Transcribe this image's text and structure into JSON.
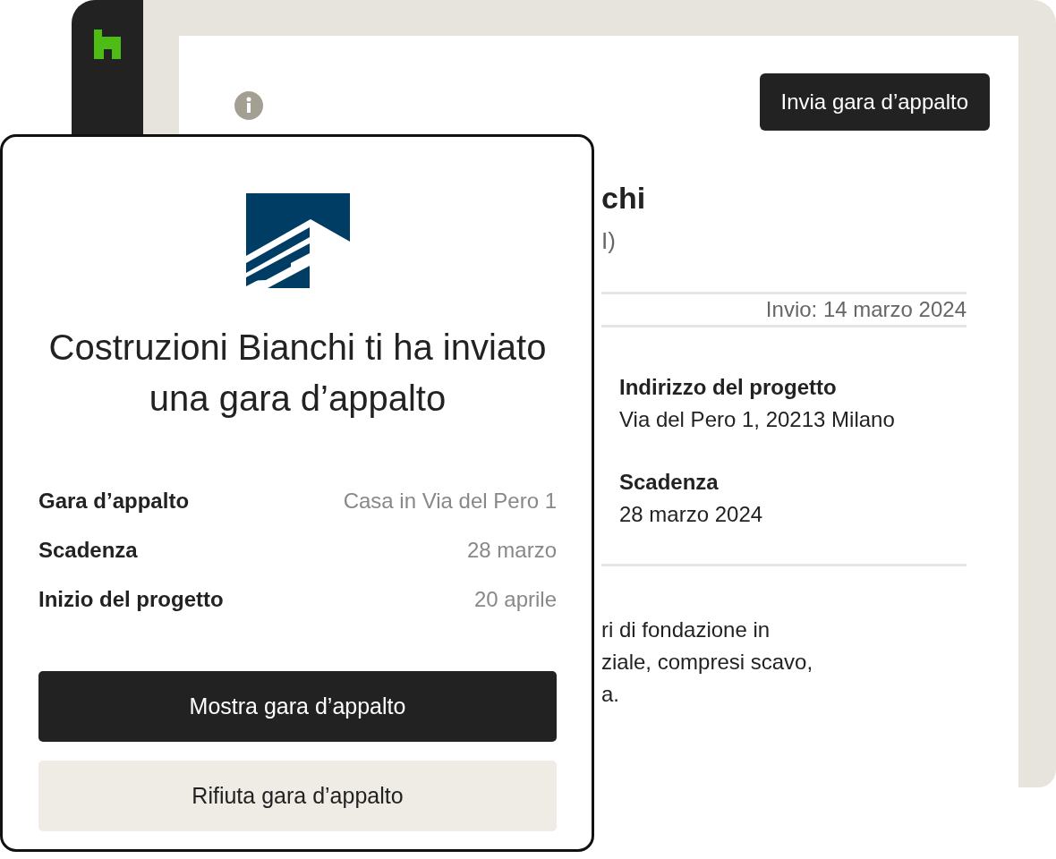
{
  "app": {
    "send_button": "Invia gara d’appalto",
    "header_fragments": [
      "chi",
      "I)"
    ],
    "sent_date": "Invio: 14 marzo 2024",
    "details": [
      {
        "label": "Indirizzo del progetto",
        "value": "Via del Pero 1, 20213 Milano"
      },
      {
        "label": "Scadenza",
        "value": "28 marzo 2024"
      }
    ],
    "description_lines": [
      "ri di fondazione in",
      "ziale, compresi scavo,",
      "a."
    ]
  },
  "card": {
    "title": "Costruzioni Bianchi ti ha inviato una gara d’appalto",
    "rows": [
      {
        "label": "Gara d’appalto",
        "value": "Casa in Via del Pero 1"
      },
      {
        "label": "Scadenza",
        "value": "28 marzo"
      },
      {
        "label": "Inizio del progetto",
        "value": "20 aprile"
      }
    ],
    "buttons": [
      {
        "label": "Mostra gara d’appalto",
        "kind": "primary"
      },
      {
        "label": "Rifiuta gara d’appalto",
        "kind": "secondary"
      }
    ]
  }
}
